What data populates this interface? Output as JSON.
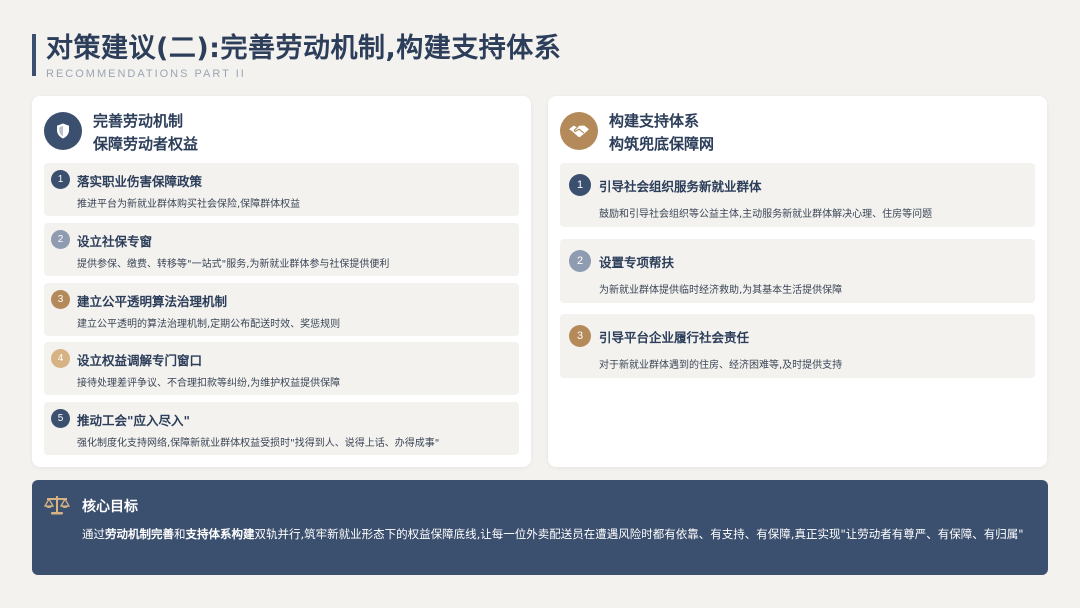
{
  "header": {
    "title": "对策建议(二):完善劳动机制,构建支持体系",
    "subtitle": "RECOMMENDATIONS PART II"
  },
  "left_card": {
    "icon": "shield-icon",
    "heading_line1": "完善劳动机制",
    "heading_line2": "保障劳动者权益",
    "items": [
      {
        "num": "1",
        "title": "落实职业伤害保障政策",
        "desc": "推进平台为新就业群体购买社会保险,保障群体权益",
        "color": "#3b4f6e"
      },
      {
        "num": "2",
        "title": "设立社保专窗",
        "desc": "提供参保、缴费、转移等\"一站式\"服务,为新就业群体参与社保提供便利",
        "color": "#8e9bb0"
      },
      {
        "num": "3",
        "title": "建立公平透明算法治理机制",
        "desc": "建立公平透明的算法治理机制,定期公布配送时效、奖惩规则",
        "color": "#b48a5a"
      },
      {
        "num": "4",
        "title": "设立权益调解专门窗口",
        "desc": "接待处理差评争议、不合理扣款等纠纷,为维护权益提供保障",
        "color": "#d7b384"
      },
      {
        "num": "5",
        "title": "推动工会\"应入尽入\"",
        "desc": "强化制度化支持网络,保障新就业群体权益受损时\"找得到人、说得上话、办得成事\"",
        "color": "#3b4f6e"
      }
    ]
  },
  "right_card": {
    "icon": "handshake-icon",
    "heading_line1": "构建支持体系",
    "heading_line2": "构筑兜底保障网",
    "items": [
      {
        "num": "1",
        "title": "引导社会组织服务新就业群体",
        "desc": "鼓励和引导社会组织等公益主体,主动服务新就业群体解决心理、住房等问题",
        "color": "#3b4f6e"
      },
      {
        "num": "2",
        "title": "设置专项帮扶",
        "desc": "为新就业群体提供临时经济救助,为其基本生活提供保障",
        "color": "#8e9bb0"
      },
      {
        "num": "3",
        "title": "引导平台企业履行社会责任",
        "desc": "对于新就业群体遇到的住房、经济困难等,及时提供支持",
        "color": "#b48a5a"
      }
    ]
  },
  "goal": {
    "icon": "balance-scale-icon",
    "title": "核心目标",
    "text_part1": "通过",
    "text_bold1": "劳动机制完善",
    "text_part2": "和",
    "text_bold2": "支持体系构建",
    "text_part3": "双轨并行,筑牢新就业形态下的权益保障底线,让每一位外卖配送员在遭遇风险时都有依靠、有支持、有保障,真正实现\"让劳动者有尊严、有保障、有归属\""
  }
}
